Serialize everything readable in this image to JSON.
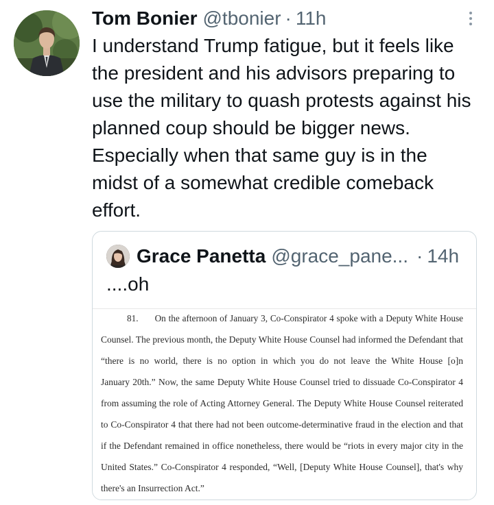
{
  "tweet": {
    "author_name": "Tom Bonier",
    "author_handle": "@tbonier",
    "separator": "·",
    "time": "11h",
    "avatar_icon": "profile-photo-man-in-suit",
    "more_icon": "vertical-ellipsis-icon",
    "text": "I understand Trump fatigue, but it feels like the president and his advisors preparing to use the military to quash protests against his planned coup should be bigger news. Especially when that same guy is in the midst of a somewhat credible comeback effort."
  },
  "quoted_tweet": {
    "author_name": "Grace Panetta",
    "author_handle": "@grace_pane...",
    "separator": "·",
    "time": "14h",
    "avatar_icon": "profile-photo-woman",
    "text": "....oh",
    "document": {
      "paragraph_number": "81.",
      "lines": [
        "On the afternoon of January 3, Co-Conspirator 4 spoke with a Deputy White House",
        "Counsel.  The previous month, the Deputy White House Counsel had informed the Defendant that",
        "“there is no world, there is no option in which you do not leave the White House [o]n",
        "January 20th.”  Now, the same Deputy White House Counsel tried to dissuade Co-Conspirator 4",
        "from assuming the role of Acting Attorney General.  The Deputy White House Counsel reiterated",
        "to Co-Conspirator 4 that there had not been outcome-determinative fraud in the election and that",
        "if the Defendant remained in office nonetheless, there would be “riots in every major city in the",
        "United States.”  Co-Conspirator 4 responded, “Well, [Deputy White House Counsel], that's why",
        "there's an Insurrection Act.”"
      ]
    }
  },
  "colors": {
    "text_primary": "#0f1419",
    "text_secondary": "#536471",
    "border": "#cfd9de"
  }
}
